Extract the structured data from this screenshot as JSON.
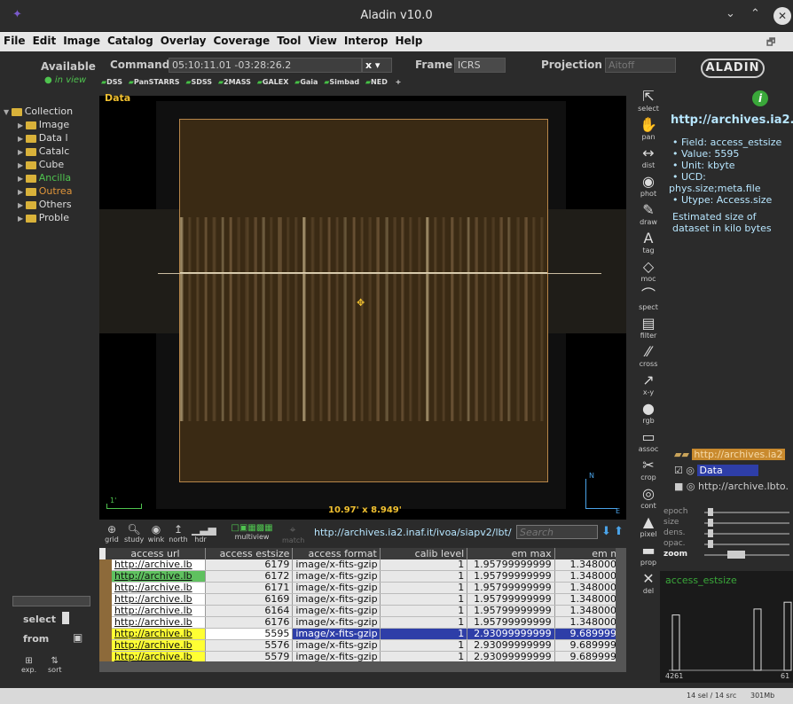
{
  "window": {
    "title": "Aladin v10.0"
  },
  "menu": [
    "File",
    "Edit",
    "Image",
    "Catalog",
    "Overlay",
    "Coverage",
    "Tool",
    "View",
    "Interop",
    "Help"
  ],
  "command": {
    "available_label": "Available",
    "in_view_label": "● in view",
    "command_label": "Command",
    "command_value": "05:10:11.01 -03:28:26.2",
    "frame_label": "Frame",
    "frame_value": "ICRS",
    "projection_label": "Projection",
    "projection_value": "Aitoff",
    "logo": "ALADIN"
  },
  "surveys": [
    "DSS",
    "PanSTARRS",
    "SDSS",
    "2MASS",
    "GALEX",
    "Gaia",
    "Simbad",
    "NED",
    "+"
  ],
  "tree": {
    "root": "Collection",
    "items": [
      {
        "label": "Image",
        "color": "#dddddd"
      },
      {
        "label": "Data l",
        "color": "#dddddd"
      },
      {
        "label": "Catalc",
        "color": "#dddddd"
      },
      {
        "label": "Cube",
        "color": "#dddddd"
      },
      {
        "label": "Ancilla",
        "color": "#4fc34f"
      },
      {
        "label": "Outrea",
        "color": "#e0953a"
      },
      {
        "label": "Others",
        "color": "#dddddd"
      },
      {
        "label": "Proble",
        "color": "#dddddd"
      }
    ]
  },
  "view": {
    "label": "Data",
    "scale": "10.97' x 8.949'",
    "scalebar": "1'",
    "north": "N",
    "east": "E"
  },
  "tools": [
    {
      "g": "⇱",
      "label": "select"
    },
    {
      "g": "✋",
      "label": "pan"
    },
    {
      "g": "↔",
      "label": "dist"
    },
    {
      "g": "◉",
      "label": "phot"
    },
    {
      "g": "✎",
      "label": "draw"
    },
    {
      "g": "A",
      "label": "tag"
    },
    {
      "g": "◇",
      "label": "moc"
    },
    {
      "g": "⌒",
      "label": "spect"
    },
    {
      "g": "▤",
      "label": "filter"
    },
    {
      "g": "⁄⁄",
      "label": "cross"
    },
    {
      "g": "↗",
      "label": "x-y"
    },
    {
      "g": "●",
      "label": "rgb"
    },
    {
      "g": "▭",
      "label": "assoc"
    },
    {
      "g": "✂",
      "label": "crop"
    },
    {
      "g": "◎",
      "label": "cont"
    },
    {
      "g": "▲",
      "label": "pixel"
    },
    {
      "g": "▬",
      "label": "prop"
    },
    {
      "g": "✕",
      "label": "del"
    }
  ],
  "info": {
    "title": "http://archives.ia2.i",
    "lines": [
      "• Field: access_estsize",
      "• Value: 5595",
      "• Unit: kbyte",
      "• UCD:",
      "phys.size;meta.file",
      "• Utype: Access.size"
    ],
    "desc": "Estimated size of dataset in kilo bytes"
  },
  "layers": [
    {
      "label": "http://archives.ia2",
      "style": "orange"
    },
    {
      "label": "Data",
      "style": "blue"
    },
    {
      "label": "http://archive.lbto.",
      "style": "plain"
    }
  ],
  "sliders": [
    "epoch",
    "size",
    "dens.",
    "opac.",
    "zoom"
  ],
  "histogram": {
    "title": "access_estsize",
    "min": "4261",
    "max": "61",
    "bars": [
      0.65,
      0.72,
      0.8
    ]
  },
  "toolbar2": {
    "items": [
      "grid",
      "study",
      "wink",
      "north",
      "hdr",
      "multiview",
      "match"
    ],
    "url": "http://archives.ia2.inaf.it/ivoa/siapv2/lbt/",
    "search_placeholder": "Search"
  },
  "table": {
    "columns": [
      "access url",
      "access estsize",
      "access format",
      "calib level",
      "em max",
      "em mi"
    ],
    "rows": [
      [
        "http://archive.lb",
        "6179",
        "image/x-fits-gzip",
        "1",
        "1.95799999999",
        "1.3480000",
        "#ffffff"
      ],
      [
        "http://archive.lb",
        "6172",
        "image/x-fits-gzip",
        "1",
        "1.95799999999",
        "1.3480000",
        "#5fc15f"
      ],
      [
        "http://archive.lb",
        "6171",
        "image/x-fits-gzip",
        "1",
        "1.95799999999",
        "1.3480000",
        "#ffffff"
      ],
      [
        "http://archive.lb",
        "6169",
        "image/x-fits-gzip",
        "1",
        "1.95799999999",
        "1.3480000",
        "#ffffff"
      ],
      [
        "http://archive.lb",
        "6164",
        "image/x-fits-gzip",
        "1",
        "1.95799999999",
        "1.3480000",
        "#ffffff"
      ],
      [
        "http://archive.lb",
        "6176",
        "image/x-fits-gzip",
        "1",
        "1.95799999999",
        "1.3480000",
        "#ffffff"
      ],
      [
        "http://archive.lb",
        "5595",
        "image/x-fits-gzip",
        "1",
        "2.93099999999",
        "9.6899999",
        "#ffff33"
      ],
      [
        "http://archive.lb",
        "5576",
        "image/x-fits-gzip",
        "1",
        "2.93099999999",
        "9.6899999",
        "#ffff33"
      ],
      [
        "http://archive.lb",
        "5579",
        "image/x-fits-gzip",
        "1",
        "2.93099999999",
        "9.6899999",
        "#ffff33"
      ]
    ],
    "selected": 6
  },
  "left_bottom": {
    "select": "select",
    "from": "from",
    "exp": "exp.",
    "sort": "sort"
  },
  "status": {
    "text": "14 sel / 14 src",
    "mem": "301Mb"
  }
}
